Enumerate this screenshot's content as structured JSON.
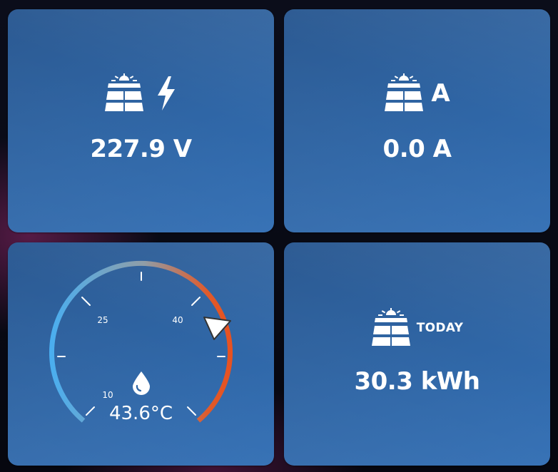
{
  "voltage": {
    "value": "227.9 V",
    "icons": [
      "solar-panel-icon",
      "lightning-bolt-icon"
    ]
  },
  "current": {
    "value": "0.0 A",
    "unit_symbol": "A",
    "icons": [
      "solar-panel-icon"
    ]
  },
  "temperature": {
    "value": "43.6°C",
    "reading": 43.6,
    "ticks": [
      "10",
      "25",
      "40"
    ],
    "gradient_colors": [
      "#4aaef0",
      "#8f9ea8",
      "#e05a2a"
    ],
    "icons": [
      "water-drop-icon"
    ]
  },
  "energy": {
    "label": "TODAY",
    "value": "30.3 kWh",
    "icons": [
      "solar-panel-icon"
    ]
  },
  "colors": {
    "card": "#2f66a6",
    "background": "#080a14",
    "text": "#ffffff"
  }
}
